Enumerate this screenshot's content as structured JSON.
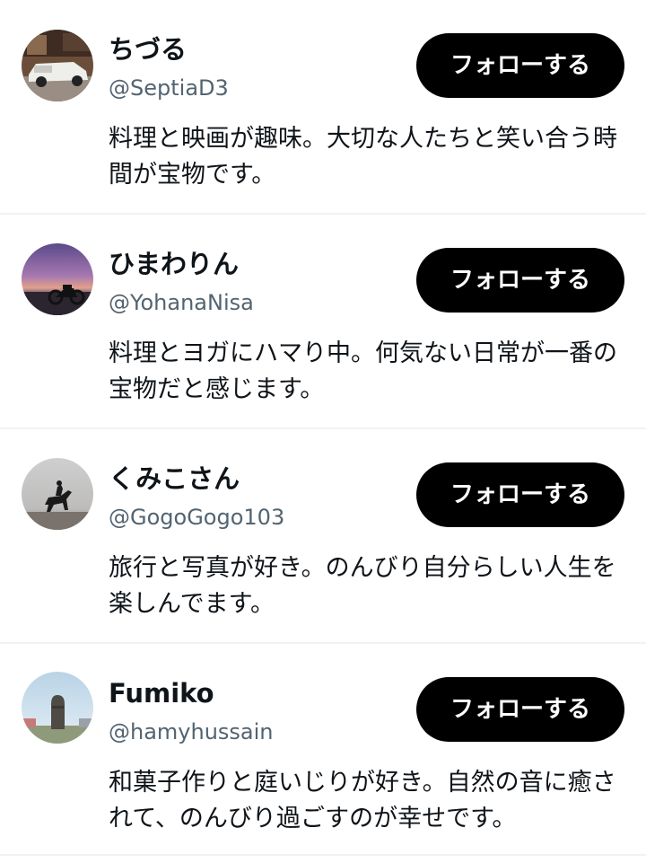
{
  "follow_label": "フォローする",
  "users": [
    {
      "display_name": "ちづる",
      "handle": "@SeptiaD3",
      "bio": "料理と映画が趣味。大切な人たちと笑い合う時間が宝物です。",
      "avatar": "white-vintage-car-photo"
    },
    {
      "display_name": "ひまわりん",
      "handle": "@YohanaNisa",
      "bio": "料理とヨガにハマり中。何気ない日常が一番の宝物だと感じます。",
      "avatar": "motorcycle-sunset-photo"
    },
    {
      "display_name": "くみこさん",
      "handle": "@GogoGogo103",
      "bio": "旅行と写真が好き。のんびり自分らしい人生を楽しんでます。",
      "avatar": "horse-rider-silhouette-photo"
    },
    {
      "display_name": "Fumiko",
      "handle": "@hamyhussain",
      "bio": "和菓子作りと庭いじりが好き。自然の音に癒されて、のんびり過ごすのが幸せです。",
      "avatar": "moai-statue-photo"
    }
  ],
  "colors": {
    "text_primary": "#0f1419",
    "text_secondary": "#536471",
    "button_bg": "#000000",
    "button_text": "#ffffff",
    "divider": "#eff3f4"
  }
}
